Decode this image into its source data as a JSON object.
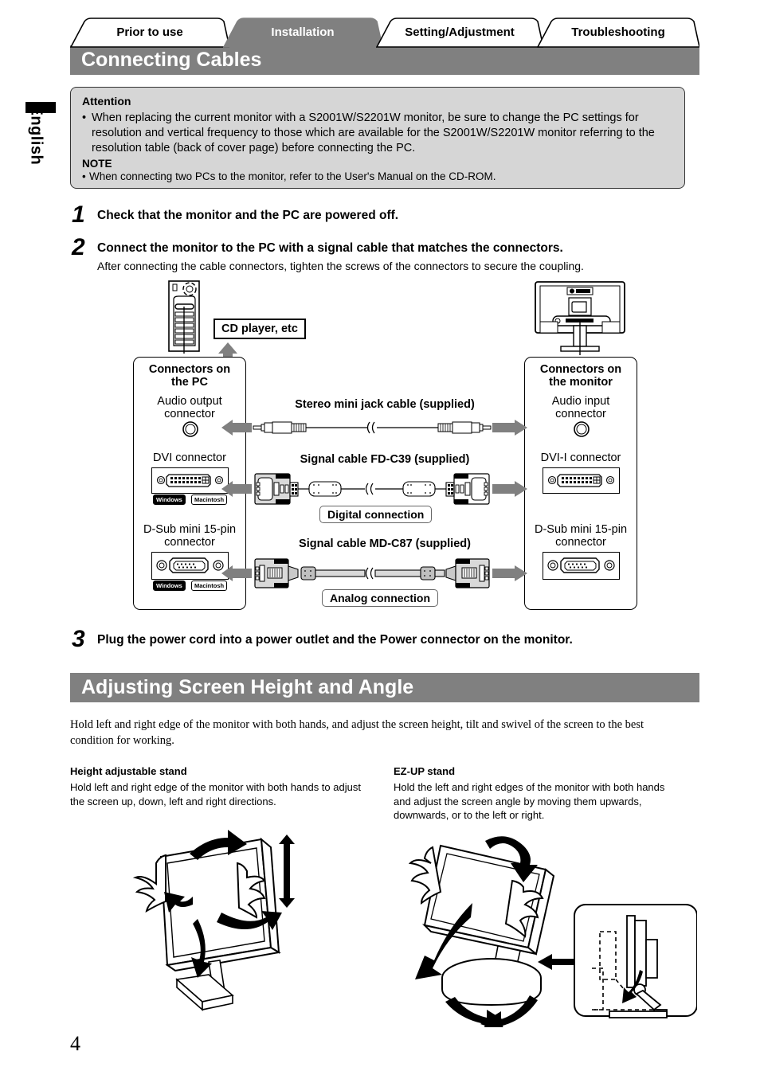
{
  "sidebar": {
    "language_label": "English"
  },
  "page": {
    "number": "4"
  },
  "tabs": [
    {
      "label": "Prior to use",
      "selected": false
    },
    {
      "label": "Installation",
      "selected": true
    },
    {
      "label": "Setting/Adjustment",
      "selected": false
    },
    {
      "label": "Troubleshooting",
      "selected": false
    }
  ],
  "sections": {
    "connecting_cables": {
      "title": "Connecting Cables"
    },
    "adjusting": {
      "title": "Adjusting Screen Height and Angle"
    }
  },
  "attention": {
    "heading": "Attention",
    "bullet": "•",
    "bullet_text": "When replacing the current monitor with a S2001W/S2201W monitor, be sure to change the PC settings for resolution and vertical frequency to those which are available for the S2001W/S2201W monitor referring to the resolution table (back of cover page) before connecting the PC.",
    "note_heading": "NOTE",
    "note_bullet": "•",
    "note_text": "When connecting two PCs to the monitor, refer to the User's Manual on the CD-ROM."
  },
  "steps": [
    {
      "number": "1",
      "text": "Check that the monitor and the PC are powered off."
    },
    {
      "number": "2",
      "text": "Connect the monitor to the PC with a signal cable that matches the connectors.",
      "sub": "After connecting the cable connectors, tighten the screws of the connectors to secure the coupling."
    },
    {
      "number": "3",
      "text": "Plug the power cord into a power outlet and the Power connector on the monitor."
    }
  ],
  "diagram": {
    "cd_player_label": "CD player, etc",
    "pc_panel": {
      "title_line1": "Connectors on",
      "title_line2": "the PC",
      "connectors": [
        {
          "label_line1": "Audio output",
          "label_line2": "connector",
          "badges": []
        },
        {
          "label_line1": "DVI connector",
          "label_line2": "",
          "badges": [
            "Windows",
            "Macintosh"
          ]
        },
        {
          "label_line1": "D-Sub mini 15-pin",
          "label_line2": "connector",
          "badges": [
            "Windows",
            "Macintosh"
          ]
        }
      ]
    },
    "monitor_panel": {
      "title_line1": "Connectors on",
      "title_line2": "the monitor",
      "connectors": [
        {
          "label_line1": "Audio input",
          "label_line2": "connector"
        },
        {
          "label_line1": "DVI-I connector",
          "label_line2": ""
        },
        {
          "label_line1": "D-Sub mini 15-pin",
          "label_line2": "connector"
        }
      ]
    },
    "cables": [
      {
        "title": "Stereo mini jack cable (supplied)",
        "connection_label": ""
      },
      {
        "title": "Signal cable FD-C39 (supplied)",
        "connection_label": "Digital connection"
      },
      {
        "title": "Signal cable MD-C87 (supplied)",
        "connection_label": "Analog connection"
      }
    ]
  },
  "adjusting_body": "Hold left and right edge of the monitor with both hands, and adjust the screen height, tilt and swivel of the screen to the best condition for working.",
  "stands": [
    {
      "heading": "Height adjustable stand",
      "text": "Hold left and right edge of the monitor with both hands to adjust the screen up, down, left and right directions."
    },
    {
      "heading": "EZ-UP stand",
      "text": "Hold the left and right edges of the monitor with both hands and adjust the screen angle by moving them upwards, downwards, or to the left or right."
    }
  ],
  "colors": {
    "bar_gray": "#808080",
    "attention_bg": "#d6d6d6",
    "arrow_gray": "#808080"
  }
}
